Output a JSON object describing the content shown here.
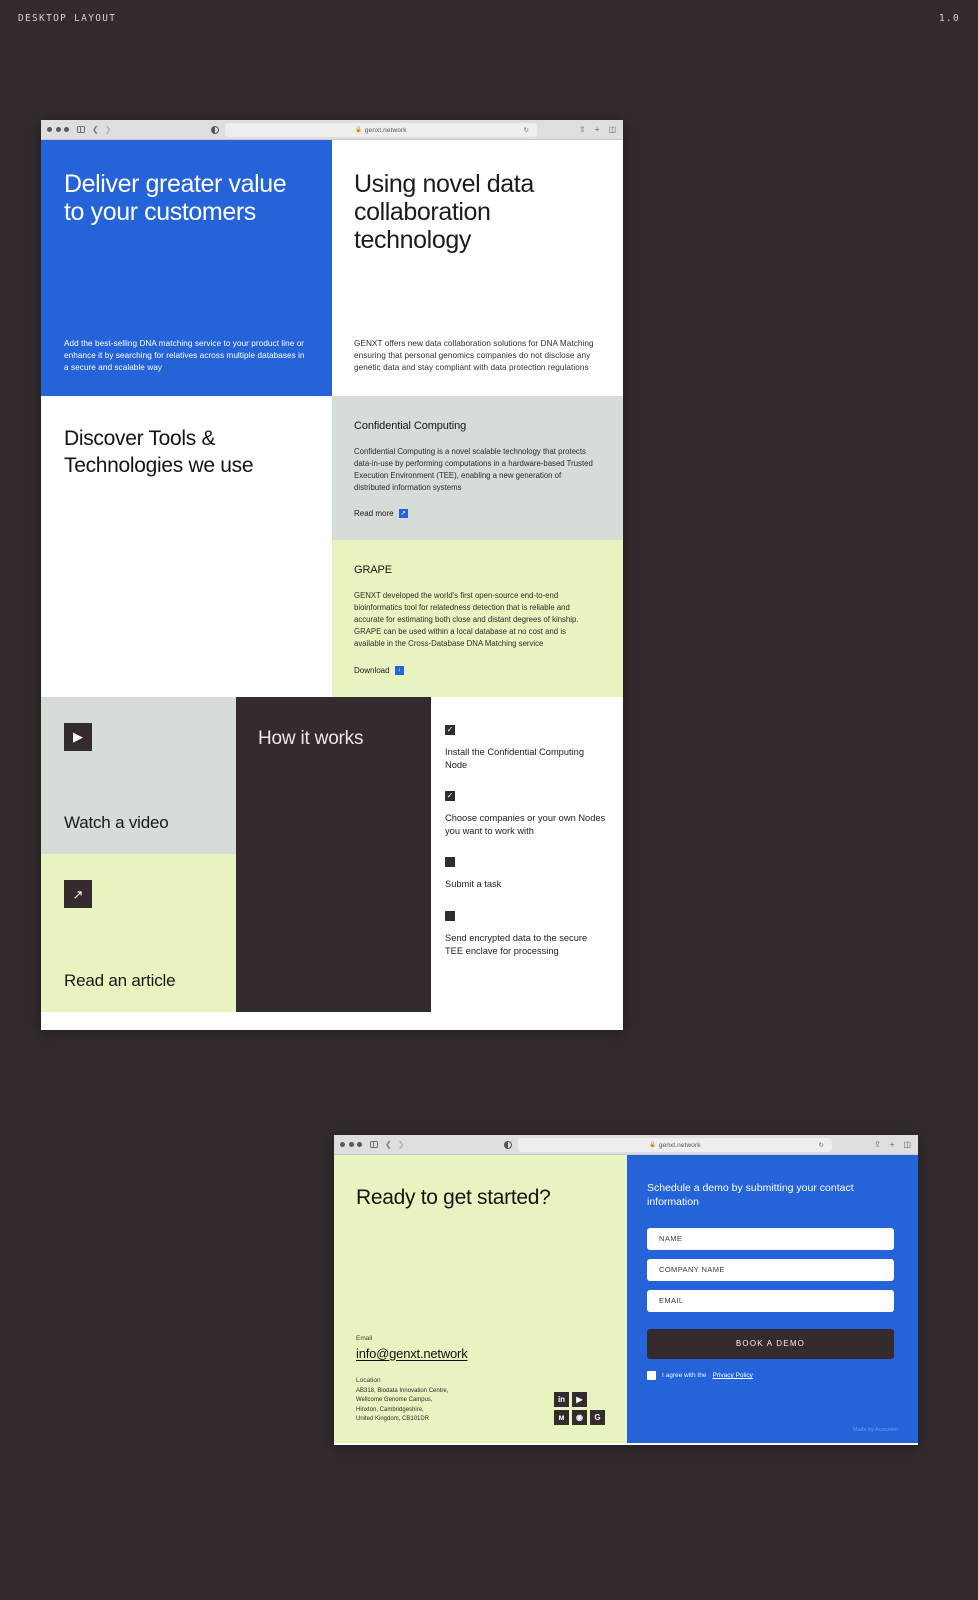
{
  "page": {
    "title": "DESKTOP  LAYOUT",
    "version": "1.0",
    "bg": "#332b2e",
    "accent_blue": "#2563d9",
    "accent_lime": "#e8f4c0",
    "accent_grey": "#d6dcd6"
  },
  "browser": {
    "url": "genxt.network",
    "lock_icon": "lock-icon",
    "reload_icon": "reload-icon",
    "back_icon": "chevron-left-icon",
    "forward_icon": "chevron-right-icon",
    "sidebar_icon": "sidebar-icon",
    "contrast_icon": "contrast-icon",
    "share_icon": "share-icon",
    "newtab_icon": "plus-icon",
    "tabs_icon": "tabs-icon"
  },
  "hero": {
    "left": {
      "heading": "Deliver greater value to your customers",
      "body": "Add the best-selling DNA matching service to your product line or enhance it by searching for relatives across multiple databases in a secure and scalable way"
    },
    "right": {
      "heading": "Using novel data collaboration technology",
      "body": "GENXT offers new data collaboration solutions for DNA Matching ensuring that personal genomics companies do not disclose any genetic data and stay compliant with data protection regulations"
    }
  },
  "tools": {
    "heading": "Discover Tools & Technologies we use",
    "cards": [
      {
        "title": "Confidential Computing",
        "body": "Confidential Computing is a novel scalable technology that protects data-in-use by performing computations in a hardware-based Trusted Execution Environment (TEE), enabling a new generation of distributed information systems",
        "action_label": "Read more",
        "action_icon": "↗",
        "theme": "grey"
      },
      {
        "title": "GRAPE",
        "body": "GENXT developed the world's first open-source end-to-end bioinformatics tool for relatedness detection that is reliable and accurate for estimating both close and distant degrees of kinship. GRAPE can be used within a local database at no cost and is available in the Cross-Database DNA Matching service",
        "action_label": "Download",
        "action_icon": "↓",
        "theme": "lime"
      }
    ]
  },
  "ctas": [
    {
      "icon": "▶",
      "icon_name": "play-icon",
      "label": "Watch a video",
      "theme": "grey"
    },
    {
      "icon": "↗",
      "icon_name": "arrow-up-right-icon",
      "label": "Read an article",
      "theme": "lime"
    }
  ],
  "how_it_works": {
    "heading": "How it works",
    "steps": [
      {
        "checked": true,
        "text": "Install the Confidential Computing Node"
      },
      {
        "checked": true,
        "text": "Choose companies or your own Nodes you want to work with"
      },
      {
        "checked": false,
        "text": "Submit a task"
      },
      {
        "checked": false,
        "text": "Send encrypted data to the secure TEE enclave for processing"
      }
    ]
  },
  "contact": {
    "heading": "Ready to get started?",
    "email_label": "Email",
    "email": "info@genxt.network",
    "location_label": "Location",
    "address": "AB318, Biodata Innovation Centre,\nWellcome Genome Campus,\nHinxton, Cambridgeshire,\nUnited Kingdom, CB101DR",
    "socials": [
      {
        "name": "linkedin-icon",
        "glyph": "in"
      },
      {
        "name": "youtube-icon",
        "glyph": "▶"
      },
      {
        "name": "empty-slot",
        "glyph": ""
      },
      {
        "name": "medium-icon",
        "glyph": "м"
      },
      {
        "name": "github-icon",
        "glyph": "◉"
      },
      {
        "name": "telegram-icon",
        "glyph": "G"
      }
    ]
  },
  "form": {
    "heading": "Schedule a demo by submitting your contact information",
    "fields": [
      {
        "name": "name-field",
        "placeholder": "NAME",
        "value": ""
      },
      {
        "name": "company-field",
        "placeholder": "COMPANY NAME",
        "value": ""
      },
      {
        "name": "email-field",
        "placeholder": "EMAIL",
        "value": ""
      }
    ],
    "submit_label": "BOOK A DEMO",
    "agree_prefix": "I agree with the",
    "agree_link": "Privacy Policy",
    "credit": "Made by Acousten"
  }
}
